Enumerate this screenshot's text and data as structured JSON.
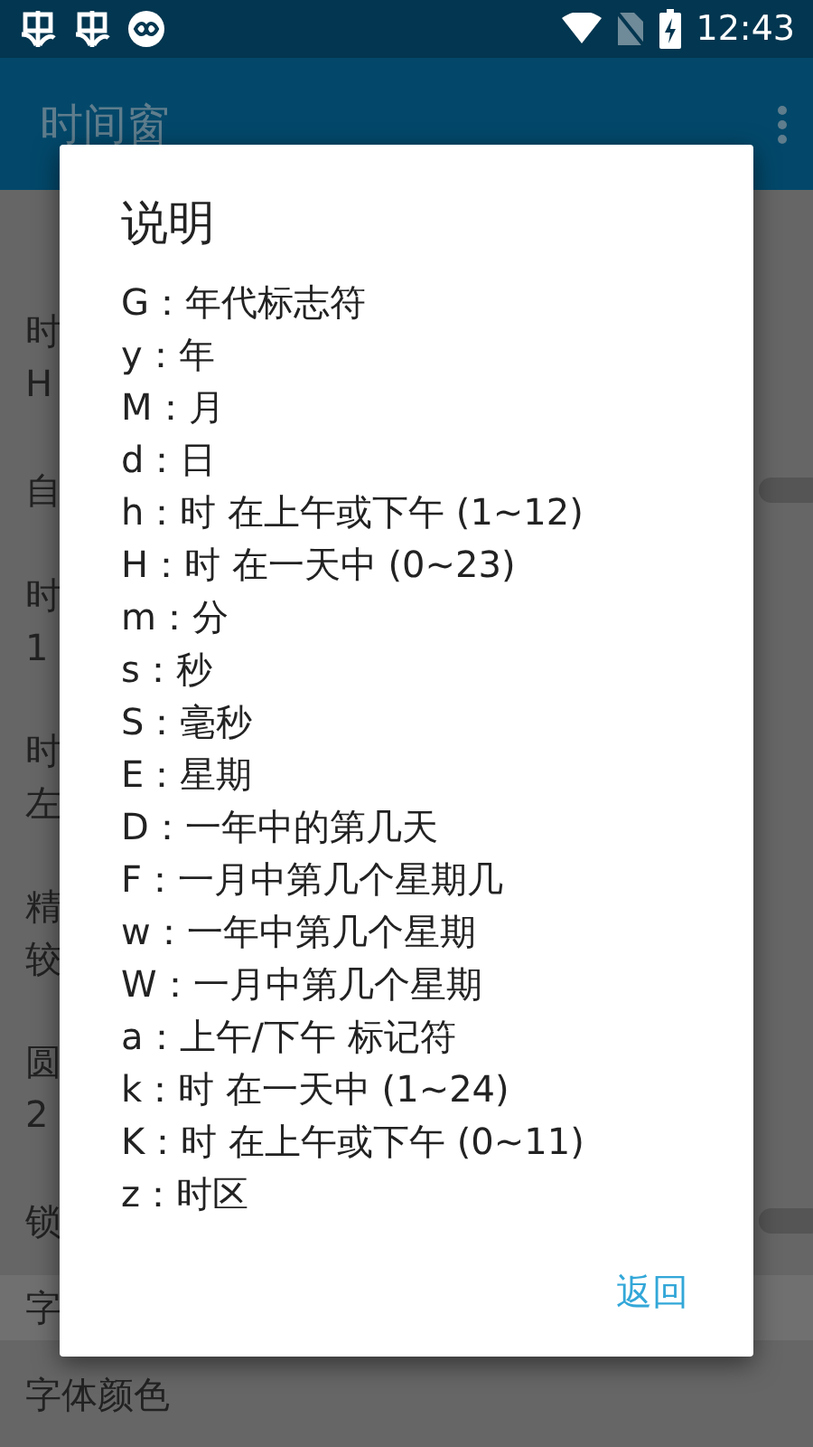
{
  "status_bar": {
    "time": "12:43"
  },
  "app_bar": {
    "title": "时间窗"
  },
  "settings": [
    {
      "kind": "double",
      "title": "时",
      "subtitle": "H"
    },
    {
      "kind": "single",
      "title": "自",
      "switch": {
        "checked": false
      }
    },
    {
      "kind": "double",
      "title": "时",
      "subtitle": "1"
    },
    {
      "kind": "double",
      "title": "时",
      "subtitle": "左"
    },
    {
      "kind": "double",
      "title": "精",
      "subtitle": "较"
    },
    {
      "kind": "double",
      "title": "圆",
      "subtitle": "2"
    },
    {
      "kind": "single",
      "title": "锁",
      "switch": {
        "checked": false
      }
    },
    {
      "kind": "header",
      "title": "字"
    },
    {
      "kind": "single",
      "title": "字体颜色"
    }
  ],
  "dialog": {
    "title": "说明",
    "lines": [
      "G：年代标志符",
      "y：年",
      "M：月",
      "d：日",
      "h：时 在上午或下午 (1~12)",
      "H：时 在一天中 (0~23)",
      "m：分",
      "s：秒",
      "S：毫秒",
      "E：星期",
      "D：一年中的第几天",
      "F：一月中第几个星期几",
      "w：一年中第几个星期",
      "W：一月中第几个星期",
      "a：上午/下午 标记符",
      "k：时 在一天中 (1~24)",
      "K：时 在上午或下午 (0~11)",
      "z：时区"
    ],
    "button": "返回"
  }
}
